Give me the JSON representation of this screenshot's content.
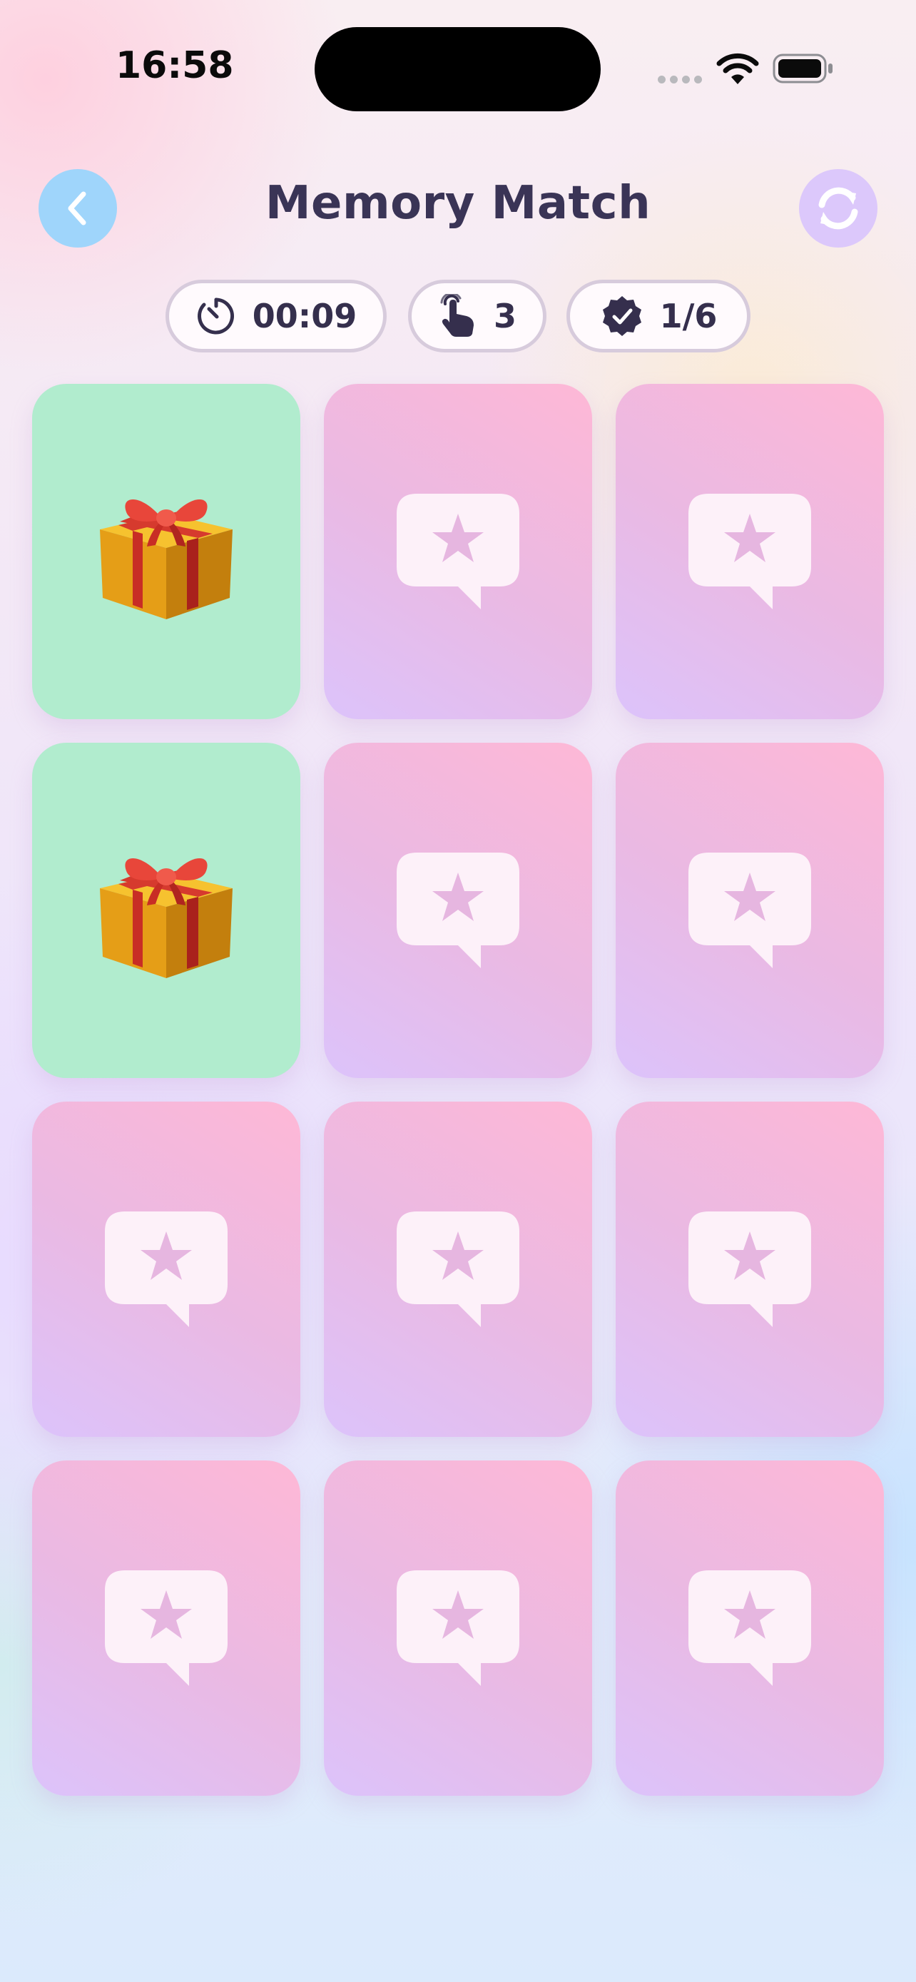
{
  "status_bar": {
    "time": "16:58"
  },
  "header": {
    "title": "Memory Match",
    "back_icon": "chevron-left-icon",
    "reset_icon": "restart-arrows-icon"
  },
  "stats": {
    "time": "00:09",
    "moves": "3",
    "matches": "1/6"
  },
  "colors": {
    "title": "#3a3456",
    "back_button": "#9fd5fb",
    "reset_button": "#dcc8fb",
    "card_back_top": "#feb8d6",
    "card_back_bottom": "#dcc3fb",
    "card_matched": "#b1ecce"
  },
  "cards": [
    {
      "state": "matched",
      "symbol": "🎁"
    },
    {
      "state": "hidden",
      "icon": "star-bubble-icon"
    },
    {
      "state": "hidden",
      "icon": "star-bubble-icon"
    },
    {
      "state": "matched",
      "symbol": "🎁"
    },
    {
      "state": "hidden",
      "icon": "star-bubble-icon"
    },
    {
      "state": "hidden",
      "icon": "star-bubble-icon"
    },
    {
      "state": "hidden",
      "icon": "star-bubble-icon"
    },
    {
      "state": "hidden",
      "icon": "star-bubble-icon"
    },
    {
      "state": "hidden",
      "icon": "star-bubble-icon"
    },
    {
      "state": "hidden",
      "icon": "star-bubble-icon"
    },
    {
      "state": "hidden",
      "icon": "star-bubble-icon"
    },
    {
      "state": "hidden",
      "icon": "star-bubble-icon"
    }
  ]
}
